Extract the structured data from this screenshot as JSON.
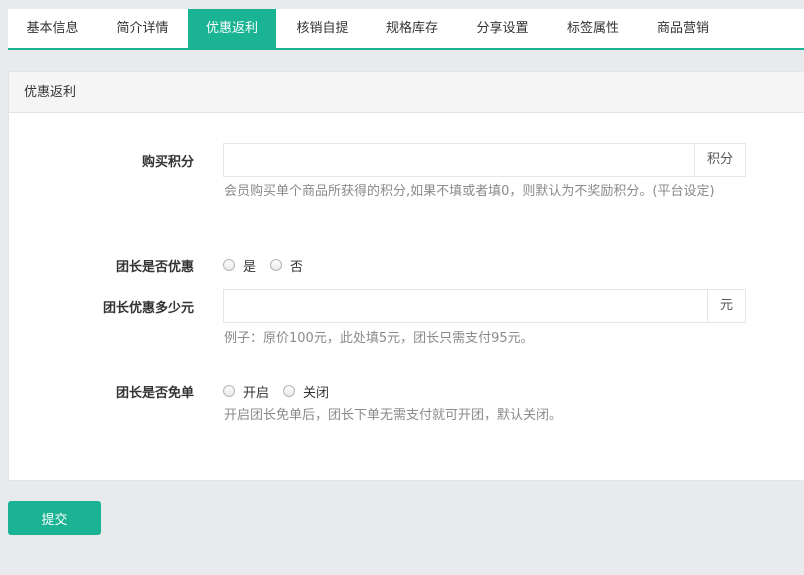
{
  "tabs": [
    {
      "label": "基本信息",
      "active": false
    },
    {
      "label": "简介详情",
      "active": false
    },
    {
      "label": "优惠返利",
      "active": true
    },
    {
      "label": "核销自提",
      "active": false
    },
    {
      "label": "规格库存",
      "active": false
    },
    {
      "label": "分享设置",
      "active": false
    },
    {
      "label": "标签属性",
      "active": false
    },
    {
      "label": "商品营销",
      "active": false
    }
  ],
  "panel": {
    "title": "优惠返利"
  },
  "form": {
    "points": {
      "label": "购买积分",
      "value": "",
      "addon": "积分",
      "help": "会员购买单个商品所获得的积分,如果不填或者填0，则默认为不奖励积分。(平台设定)"
    },
    "leader_discount": {
      "label": "团长是否优惠",
      "options": [
        "是",
        "否"
      ],
      "selected": null
    },
    "leader_amount": {
      "label": "团长优惠多少元",
      "value": "",
      "addon": "元",
      "help": "例子：原价100元，此处填5元，团长只需支付95元。"
    },
    "leader_free": {
      "label": "团长是否免单",
      "options": [
        "开启",
        "关闭"
      ],
      "selected": null,
      "help": "开启团长免单后，团长下单无需支付就可开团，默认关闭。"
    }
  },
  "actions": {
    "submit_label": "提交"
  },
  "colors": {
    "accent": "#1ab394",
    "background": "#e9eaed"
  }
}
